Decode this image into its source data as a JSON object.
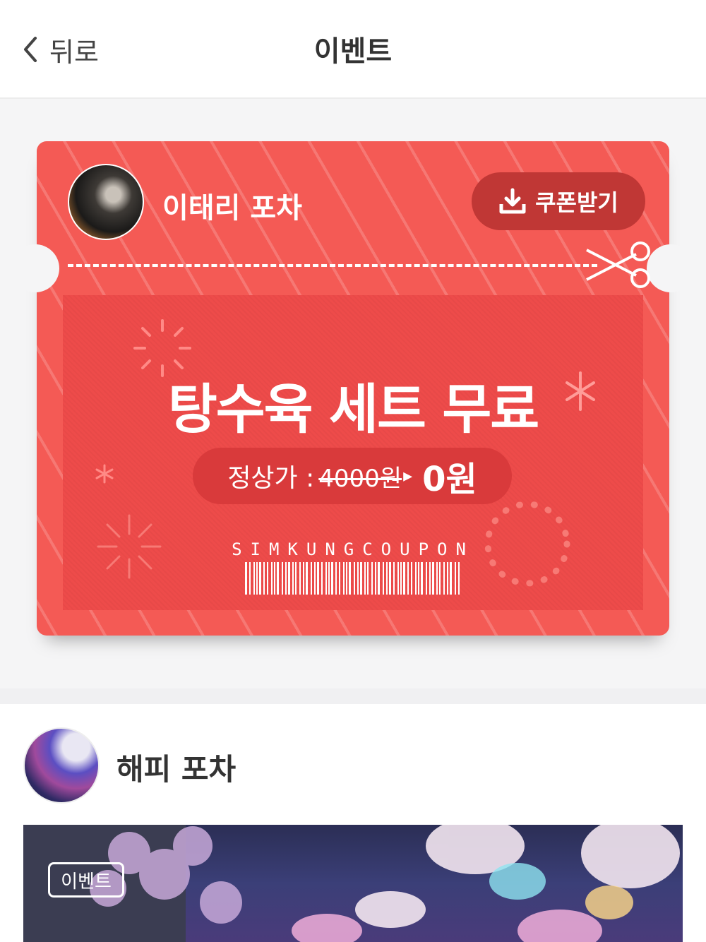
{
  "header": {
    "back_label": "뒤로",
    "title": "이벤트"
  },
  "coupon": {
    "shop_name": "이태리 포차",
    "download_button_label": "쿠폰받기",
    "headline": "탕수육 세트 무료",
    "price_label": "정상가 :",
    "original_price": "4000원",
    "sale_price": "0원",
    "barcode_text": "SIMKUNGCOUPON",
    "colors": {
      "coupon_bg": "#f45a55",
      "panel_bg": "#ee4b4a",
      "button_bg": "#c03735",
      "pill_bg": "#d93a3b"
    }
  },
  "event_post": {
    "shop_name": "해피 포차",
    "badge_label": "이벤트"
  },
  "icons": {
    "back": "chevron-left-icon",
    "download": "download-icon",
    "scissors": "scissors-icon"
  }
}
